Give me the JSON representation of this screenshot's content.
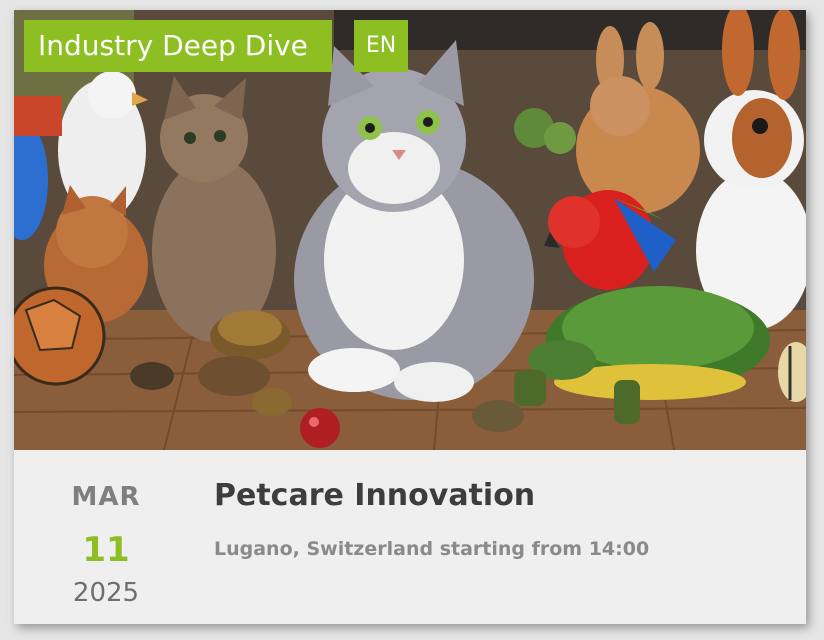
{
  "card": {
    "image": {
      "alt_subject": "pets-photo"
    },
    "badges": {
      "category": "Industry Deep Dive",
      "language": "EN"
    },
    "date": {
      "month": "MAR",
      "day": "11",
      "year": "2025"
    },
    "title": "Petcare Innovation",
    "subtitle": "Lugano, Switzerland starting from 14:00"
  },
  "colors": {
    "accent": "#8dbe22",
    "title": "#3d3d3d",
    "muted": "#8a8a8a",
    "card_bg": "#efefef"
  }
}
